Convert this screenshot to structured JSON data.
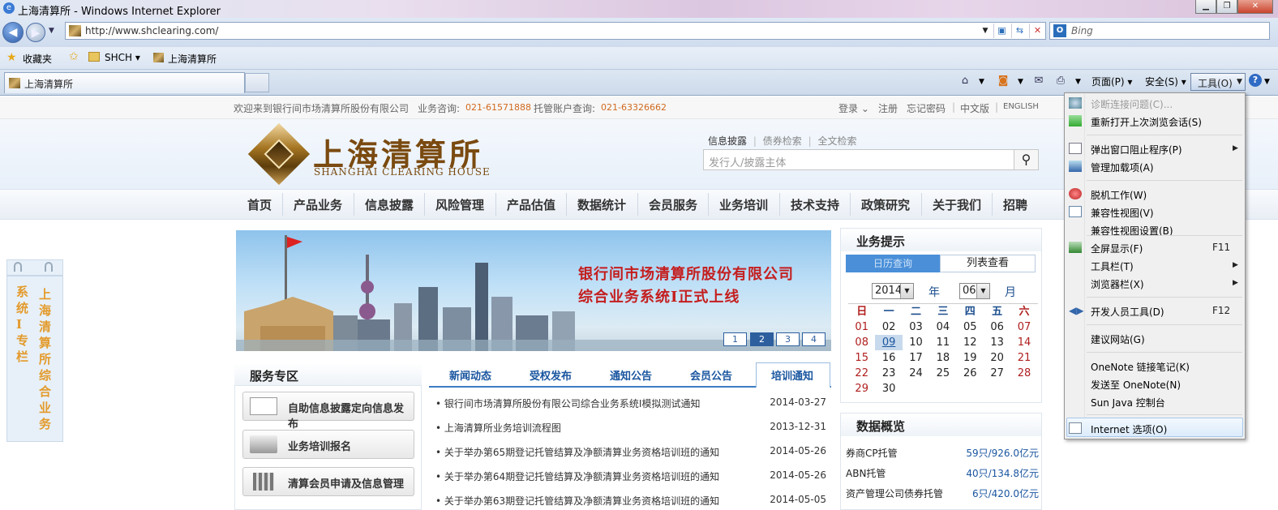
{
  "window": {
    "title": "上海清算所 - Windows Internet Explorer"
  },
  "nav": {
    "url": "http://www.shclearing.com/",
    "search_placeholder": "Bing"
  },
  "favorites": {
    "label": "收藏夹",
    "items": [
      "SHCH",
      "上海清算所"
    ]
  },
  "tabs": [
    {
      "label": "上海清算所"
    }
  ],
  "command_bar": {
    "page": "页面(P)",
    "safety": "安全(S)",
    "tools": "工具(O)"
  },
  "tools_menu": {
    "items": [
      {
        "label": "诊断连接问题(C)...",
        "disabled": true
      },
      {
        "label": "重新打开上次浏览会话(S)"
      },
      {
        "label": "弹出窗口阻止程序(P)",
        "submenu": true
      },
      {
        "label": "管理加载项(A)"
      },
      {
        "label": "脱机工作(W)"
      },
      {
        "label": "兼容性视图(V)"
      },
      {
        "label": "兼容性视图设置(B)"
      },
      {
        "label": "全屏显示(F)",
        "shortcut": "F11"
      },
      {
        "label": "工具栏(T)",
        "submenu": true
      },
      {
        "label": "浏览器栏(X)",
        "submenu": true
      },
      {
        "label": "开发人员工具(D)",
        "shortcut": "F12"
      },
      {
        "label": "建议网站(G)"
      },
      {
        "label": "OneNote 链接笔记(K)"
      },
      {
        "label": "发送至 OneNote(N)"
      },
      {
        "label": "Sun Java 控制台"
      },
      {
        "label": "Internet 选项(O)",
        "highlighted": true
      }
    ]
  },
  "site": {
    "welcome": "欢迎来到银行间市场清算所股份有限公司",
    "biz_label": "业务咨询:",
    "biz_phone": "021-61571888",
    "custody_label": "托管账户查询:",
    "custody_phone": "021-63326662",
    "top_links": [
      "登录",
      "注册",
      "忘记密码",
      "中文版",
      "ENGLISH"
    ],
    "logo_cn": "上海清算所",
    "logo_en": "SHANGHAI CLEARING HOUSE",
    "search_tabs": [
      "信息披露",
      "债券检索",
      "全文检索"
    ],
    "search_placeholder": "发行人/披露主体",
    "menu": [
      "首页",
      "产品业务",
      "信息披露",
      "风险管理",
      "产品估值",
      "数据统计",
      "会员服务",
      "业务培训",
      "技术支持",
      "政策研究",
      "关于我们",
      "招聘"
    ],
    "float_col1": "系统I专栏",
    "float_col2": "上海清算所综合业务",
    "banner_line1": "银行间市场清算所股份有限公司",
    "banner_line2": "综合业务系统I正式上线",
    "banner_pages": [
      "1",
      "2",
      "3",
      "4"
    ],
    "service_title": "服务专区",
    "service_items": [
      "自助信息披露定向信息发布",
      "业务培训报名",
      "清算会员申请及信息管理"
    ],
    "news_tabs": [
      "新闻动态",
      "受权发布",
      "通知公告",
      "会员公告",
      "培训通知"
    ],
    "news": [
      {
        "title": "银行间市场清算所股份有限公司综合业务系统I模拟测试通知",
        "date": "2014-03-27"
      },
      {
        "title": "上海清算所业务培训流程图",
        "date": "2013-12-31"
      },
      {
        "title": "关于举办第65期登记托管结算及净额清算业务资格培训班的通知",
        "date": "2014-05-26"
      },
      {
        "title": "关于举办第64期登记托管结算及净额清算业务资格培训班的通知",
        "date": "2014-05-26"
      },
      {
        "title": "关于举办第63期登记托管结算及净额清算业务资格培训班的通知",
        "date": "2014-05-05"
      }
    ],
    "tips_title": "业务提示",
    "cal_tab_left": "日历查询",
    "cal_tab_right": "列表查看",
    "cal_year": "2014",
    "cal_year_label": "年",
    "cal_month": "06",
    "cal_month_label": "月",
    "weekdays": [
      "日",
      "一",
      "二",
      "三",
      "四",
      "五",
      "六"
    ],
    "days": [
      "01",
      "02",
      "03",
      "04",
      "05",
      "06",
      "07",
      "08",
      "09",
      "10",
      "11",
      "12",
      "13",
      "14",
      "15",
      "16",
      "17",
      "18",
      "19",
      "20",
      "21",
      "22",
      "23",
      "24",
      "25",
      "26",
      "27",
      "28",
      "29",
      "30"
    ],
    "today": "09",
    "data_title": "数据概览",
    "data_rows": [
      {
        "label": "券商CP托管",
        "value": "59只/926.0亿元"
      },
      {
        "label": "ABN托管",
        "value": "40只/134.8亿元"
      },
      {
        "label": "资产管理公司债券托管",
        "value": "6只/420.0亿元"
      }
    ]
  }
}
